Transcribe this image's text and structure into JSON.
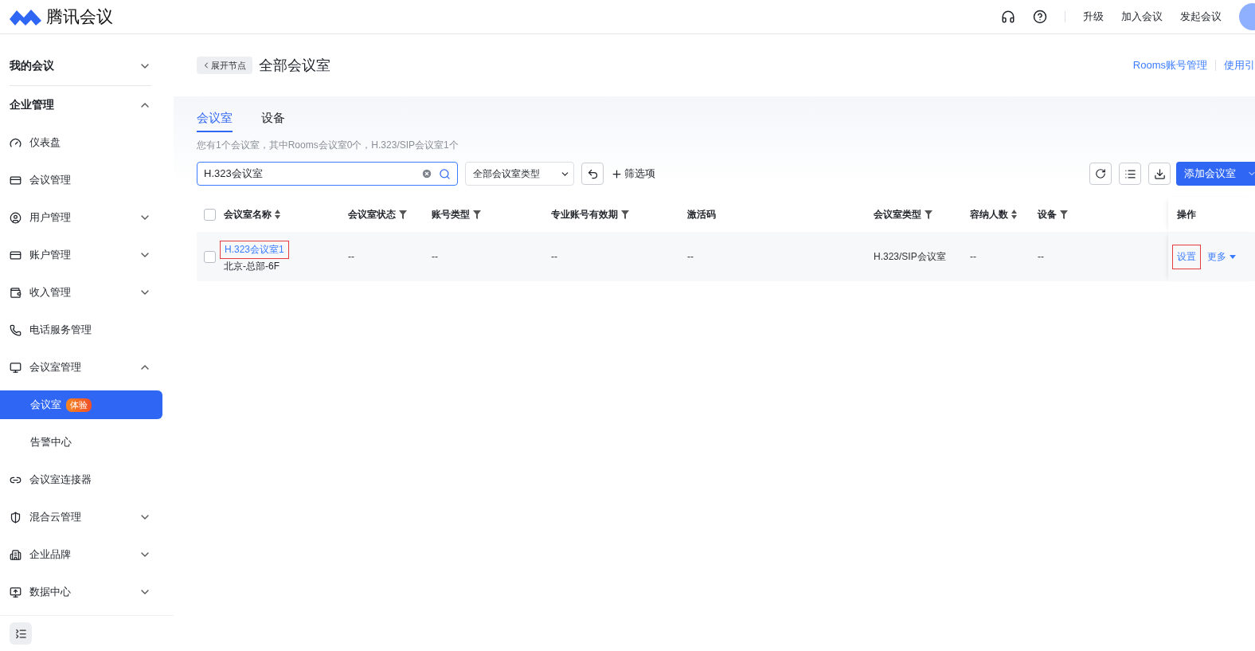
{
  "header": {
    "brand": "腾讯会议",
    "actions": [
      "升级",
      "加入会议",
      "发起会议"
    ]
  },
  "sidebar": {
    "sections": [
      {
        "label": "我的会议",
        "expanded": false
      },
      {
        "label": "企业管理",
        "expanded": true,
        "items": [
          {
            "label": "仪表盘"
          },
          {
            "label": "会议管理"
          },
          {
            "label": "用户管理",
            "expanded": false
          },
          {
            "label": "账户管理",
            "expanded": false
          },
          {
            "label": "收入管理",
            "expanded": false
          },
          {
            "label": "电话服务管理"
          },
          {
            "label": "会议室管理",
            "expanded": true,
            "children": [
              {
                "label": "会议室",
                "badge": "体验",
                "selected": true
              },
              {
                "label": "告警中心",
                "selected": false
              }
            ]
          },
          {
            "label": "会议室连接器"
          },
          {
            "label": "混合云管理",
            "expanded": false
          },
          {
            "label": "企业品牌",
            "expanded": false
          },
          {
            "label": "数据中心",
            "expanded": false
          }
        ]
      }
    ]
  },
  "page": {
    "back_button": "展开节点",
    "title": "全部会议室",
    "links": [
      "Rooms账号管理",
      "使用引"
    ]
  },
  "tabs": [
    {
      "label": "会议室",
      "selected": true
    },
    {
      "label": "设备",
      "selected": false
    }
  ],
  "summary": "您有1个会议室，其中Rooms会议室0个，H.323/SIP会议室1个",
  "toolbar": {
    "search_value": "H.323会议室",
    "type_select": "全部会议室类型",
    "filter_button": "筛选项",
    "add_button": "添加会议室"
  },
  "table": {
    "columns": [
      {
        "kind": "checkbox",
        "checked": false
      },
      {
        "label": "会议室名称",
        "kind": "sort"
      },
      {
        "label": "会议室状态",
        "kind": "filter"
      },
      {
        "label": "账号类型",
        "kind": "filter"
      },
      {
        "label": "专业账号有效期",
        "kind": "filter"
      },
      {
        "label": "激活码",
        "kind": "plain"
      },
      {
        "label": "会议室类型",
        "kind": "filter"
      },
      {
        "label": "容纳人数",
        "kind": "sort"
      },
      {
        "label": "设备",
        "kind": "filter"
      },
      {
        "label": "操作",
        "kind": "plain"
      }
    ],
    "rows": [
      {
        "cells": [
          {
            "kind": "checkbox",
            "checked": false
          },
          {
            "kind": "room",
            "name": "H.323会议室1",
            "highlighted": true,
            "location": "北京-总部-6F"
          },
          {
            "kind": "text",
            "text": "--"
          },
          {
            "kind": "text",
            "text": "--"
          },
          {
            "kind": "text",
            "text": "--"
          },
          {
            "kind": "text",
            "text": "--"
          },
          {
            "kind": "text",
            "text": "H.323/SIP会议室"
          },
          {
            "kind": "text",
            "text": "--"
          },
          {
            "kind": "text",
            "text": "--"
          },
          {
            "kind": "actions",
            "actions": [
              {
                "label": "设置",
                "kind": "link",
                "highlighted": true
              },
              {
                "label": "更多",
                "kind": "menu",
                "highlighted": false
              }
            ]
          }
        ]
      }
    ]
  }
}
